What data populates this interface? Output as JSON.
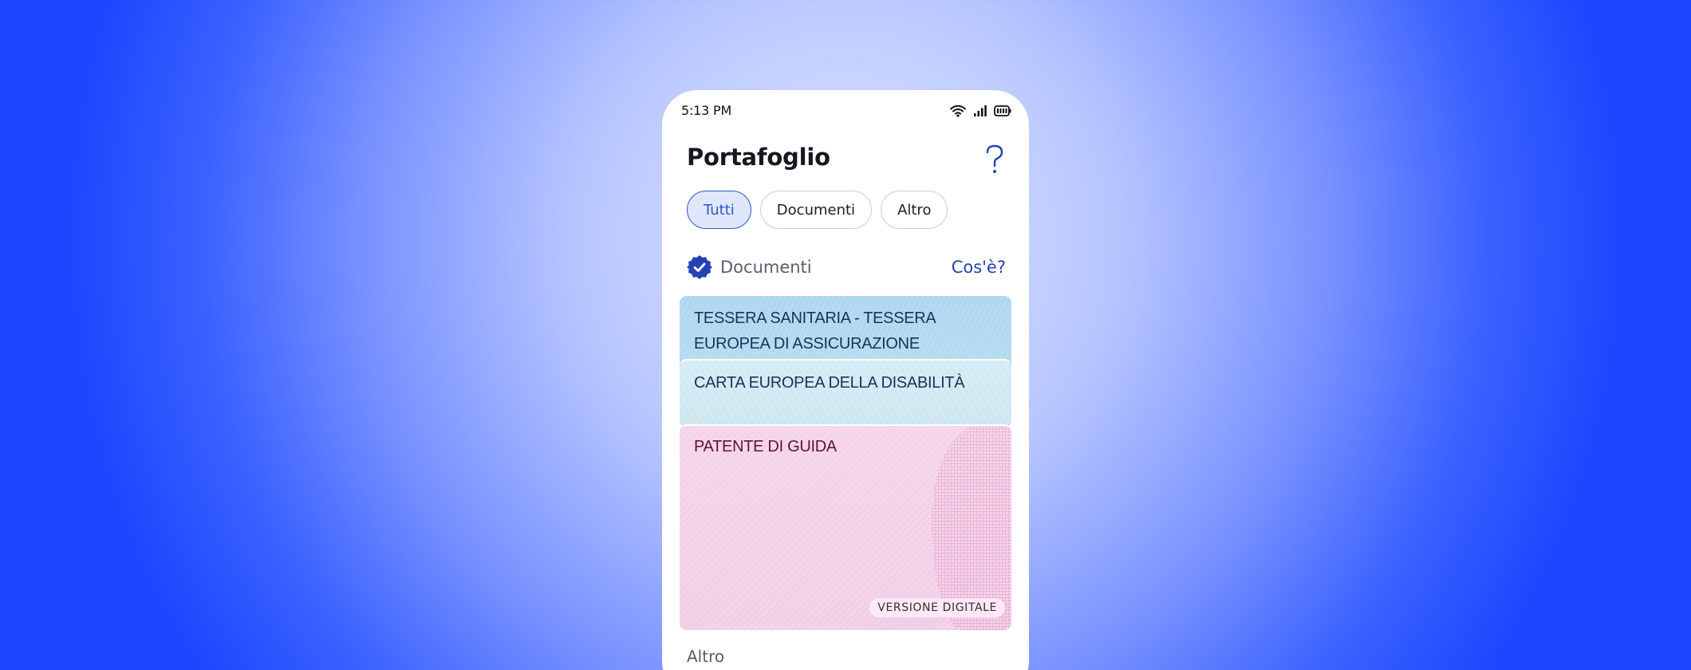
{
  "status_bar": {
    "time": "5:13 PM",
    "icons": [
      "wifi-icon",
      "signal-icon",
      "battery-icon"
    ]
  },
  "header": {
    "title": "Portafoglio",
    "help_icon": "help-icon"
  },
  "filters": [
    {
      "label": "Tutti",
      "active": true
    },
    {
      "label": "Documenti",
      "active": false
    },
    {
      "label": "Altro",
      "active": false
    }
  ],
  "documents_section": {
    "icon": "verified-check-icon",
    "title": "Documenti",
    "link": "Cos'è?"
  },
  "cards": [
    {
      "title": "TESSERA SANITARIA - TESSERA EUROPEA DI ASSICURAZIONE MALATTIA"
    },
    {
      "title": "CARTA EUROPEA DELLA DISABILITÀ"
    },
    {
      "title": "PATENTE DI GUIDA",
      "badge": "VERSIONE DIGITALE"
    }
  ],
  "other_section": {
    "title": "Altro"
  },
  "colors": {
    "accent": "#2a56c6",
    "chip_active_bg": "#dfe7fb",
    "card_health": "#aed6ef",
    "card_disability": "#d4ebf4",
    "card_license": "#f5d3ea"
  }
}
